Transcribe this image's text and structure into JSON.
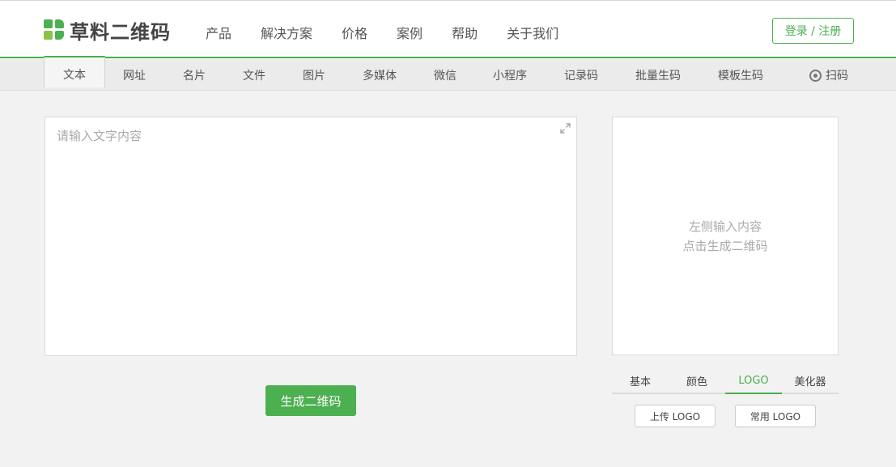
{
  "brand": {
    "name": "草料二维码"
  },
  "nav": [
    "产品",
    "解决方案",
    "价格",
    "案例",
    "帮助",
    "关于我们"
  ],
  "login_label": "登录 / 注册",
  "tabs": [
    "文本",
    "网址",
    "名片",
    "文件",
    "图片",
    "多媒体",
    "微信",
    "小程序",
    "记录码",
    "批量生码",
    "模板生码"
  ],
  "scan_label": "扫码",
  "editor": {
    "placeholder": "请输入文字内容",
    "value": ""
  },
  "generate_label": "生成二维码",
  "preview": {
    "line1": "左侧输入内容",
    "line2": "点击生成二维码"
  },
  "style_tabs": [
    "基本",
    "颜色",
    "LOGO",
    "美化器"
  ],
  "logo_buttons": {
    "upload": "上传 LOGO",
    "common": "常用 LOGO"
  },
  "colors": {
    "accent": "#4caf50",
    "accent_light": "#8bc34a",
    "background": "#f2f2f2"
  }
}
